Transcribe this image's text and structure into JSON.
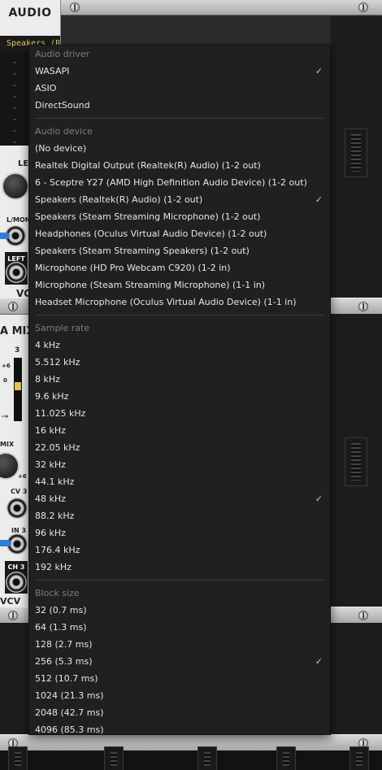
{
  "module": {
    "title": "AUDIO",
    "device_display": "Speakers (R",
    "labels": {
      "level": "LEV",
      "lmon": "L/MON",
      "left": "LEFT",
      "vc": "VC",
      "mix_title": "A MIX",
      "mix_num": "3",
      "plus6": "+6",
      "zero": "0",
      "minus_inf": "-∞",
      "mix": "MIX",
      "plus6b": "+6",
      "cv3": "CV 3",
      "in3": "IN 3",
      "ch3": "CH 3",
      "vcv": "VCV"
    }
  },
  "menu": {
    "sections": [
      {
        "header": "Audio driver",
        "items": [
          {
            "label": "WASAPI",
            "checked": true
          },
          {
            "label": "ASIO",
            "checked": false
          },
          {
            "label": "DirectSound",
            "checked": false
          }
        ]
      },
      {
        "header": "Audio device",
        "items": [
          {
            "label": "(No device)",
            "checked": false
          },
          {
            "label": "Realtek Digital Output (Realtek(R) Audio) (1-2 out)",
            "checked": false
          },
          {
            "label": "6 - Sceptre Y27 (AMD High Definition Audio Device) (1-2 out)",
            "checked": false
          },
          {
            "label": "Speakers (Realtek(R) Audio) (1-2 out)",
            "checked": true
          },
          {
            "label": "Speakers (Steam Streaming Microphone) (1-2 out)",
            "checked": false
          },
          {
            "label": "Headphones (Oculus Virtual Audio Device) (1-2 out)",
            "checked": false
          },
          {
            "label": "Speakers (Steam Streaming Speakers) (1-2 out)",
            "checked": false
          },
          {
            "label": "Microphone (HD Pro Webcam C920) (1-2 in)",
            "checked": false
          },
          {
            "label": "Microphone (Steam Streaming Microphone) (1-1 in)",
            "checked": false
          },
          {
            "label": "Headset Microphone (Oculus Virtual Audio Device) (1-1 in)",
            "checked": false
          }
        ]
      },
      {
        "header": "Sample rate",
        "items": [
          {
            "label": "4 kHz",
            "checked": false
          },
          {
            "label": "5.512 kHz",
            "checked": false
          },
          {
            "label": "8 kHz",
            "checked": false
          },
          {
            "label": "9.6 kHz",
            "checked": false
          },
          {
            "label": "11.025 kHz",
            "checked": false
          },
          {
            "label": "16 kHz",
            "checked": false
          },
          {
            "label": "22.05 kHz",
            "checked": false
          },
          {
            "label": "32 kHz",
            "checked": false
          },
          {
            "label": "44.1 kHz",
            "checked": false
          },
          {
            "label": "48 kHz",
            "checked": true
          },
          {
            "label": "88.2 kHz",
            "checked": false
          },
          {
            "label": "96 kHz",
            "checked": false
          },
          {
            "label": "176.4 kHz",
            "checked": false
          },
          {
            "label": "192 kHz",
            "checked": false
          }
        ]
      },
      {
        "header": "Block size",
        "items": [
          {
            "label": "32 (0.7 ms)",
            "checked": false
          },
          {
            "label": "64 (1.3 ms)",
            "checked": false
          },
          {
            "label": "128 (2.7 ms)",
            "checked": false
          },
          {
            "label": "256 (5.3 ms)",
            "checked": true
          },
          {
            "label": "512 (10.7 ms)",
            "checked": false
          },
          {
            "label": "1024 (21.3 ms)",
            "checked": false
          },
          {
            "label": "2048 (42.7 ms)",
            "checked": false
          },
          {
            "label": "4096 (85.3 ms)",
            "checked": false
          }
        ]
      }
    ],
    "check_glyph": "✓"
  },
  "colors": {
    "menu_bg": "#202020",
    "menu_text": "#e6e6e6",
    "header_text": "#7d7d7d",
    "cable": "#2f7fd8",
    "display_text": "#e3c86b"
  }
}
